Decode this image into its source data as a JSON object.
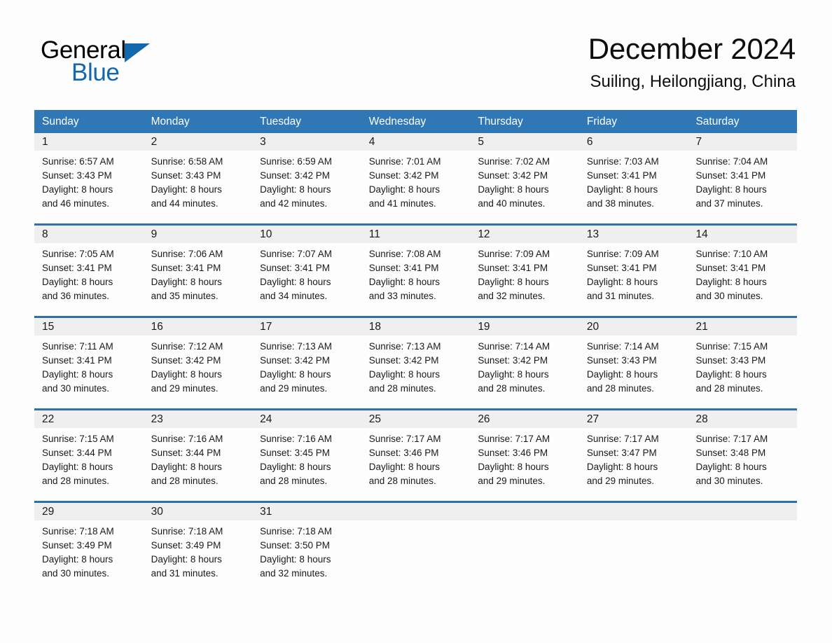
{
  "brand": {
    "name_part1": "General",
    "name_part2": "Blue",
    "triangle_color": "#1268ad"
  },
  "header": {
    "month_title": "December 2024",
    "location": "Suiling, Heilongjiang, China"
  },
  "theme": {
    "header_blue": "#3077b6",
    "row_divider_blue": "#2f6fae",
    "daynum_band": "#efefef",
    "page_background": "#fdfdfd",
    "text_color": "#1a1a1a"
  },
  "calendar": {
    "weekdays": [
      "Sunday",
      "Monday",
      "Tuesday",
      "Wednesday",
      "Thursday",
      "Friday",
      "Saturday"
    ],
    "weeks": [
      [
        {
          "day": "1",
          "lines": [
            "Sunrise: 6:57 AM",
            "Sunset: 3:43 PM",
            "Daylight: 8 hours",
            "and 46 minutes."
          ]
        },
        {
          "day": "2",
          "lines": [
            "Sunrise: 6:58 AM",
            "Sunset: 3:43 PM",
            "Daylight: 8 hours",
            "and 44 minutes."
          ]
        },
        {
          "day": "3",
          "lines": [
            "Sunrise: 6:59 AM",
            "Sunset: 3:42 PM",
            "Daylight: 8 hours",
            "and 42 minutes."
          ]
        },
        {
          "day": "4",
          "lines": [
            "Sunrise: 7:01 AM",
            "Sunset: 3:42 PM",
            "Daylight: 8 hours",
            "and 41 minutes."
          ]
        },
        {
          "day": "5",
          "lines": [
            "Sunrise: 7:02 AM",
            "Sunset: 3:42 PM",
            "Daylight: 8 hours",
            "and 40 minutes."
          ]
        },
        {
          "day": "6",
          "lines": [
            "Sunrise: 7:03 AM",
            "Sunset: 3:41 PM",
            "Daylight: 8 hours",
            "and 38 minutes."
          ]
        },
        {
          "day": "7",
          "lines": [
            "Sunrise: 7:04 AM",
            "Sunset: 3:41 PM",
            "Daylight: 8 hours",
            "and 37 minutes."
          ]
        }
      ],
      [
        {
          "day": "8",
          "lines": [
            "Sunrise: 7:05 AM",
            "Sunset: 3:41 PM",
            "Daylight: 8 hours",
            "and 36 minutes."
          ]
        },
        {
          "day": "9",
          "lines": [
            "Sunrise: 7:06 AM",
            "Sunset: 3:41 PM",
            "Daylight: 8 hours",
            "and 35 minutes."
          ]
        },
        {
          "day": "10",
          "lines": [
            "Sunrise: 7:07 AM",
            "Sunset: 3:41 PM",
            "Daylight: 8 hours",
            "and 34 minutes."
          ]
        },
        {
          "day": "11",
          "lines": [
            "Sunrise: 7:08 AM",
            "Sunset: 3:41 PM",
            "Daylight: 8 hours",
            "and 33 minutes."
          ]
        },
        {
          "day": "12",
          "lines": [
            "Sunrise: 7:09 AM",
            "Sunset: 3:41 PM",
            "Daylight: 8 hours",
            "and 32 minutes."
          ]
        },
        {
          "day": "13",
          "lines": [
            "Sunrise: 7:09 AM",
            "Sunset: 3:41 PM",
            "Daylight: 8 hours",
            "and 31 minutes."
          ]
        },
        {
          "day": "14",
          "lines": [
            "Sunrise: 7:10 AM",
            "Sunset: 3:41 PM",
            "Daylight: 8 hours",
            "and 30 minutes."
          ]
        }
      ],
      [
        {
          "day": "15",
          "lines": [
            "Sunrise: 7:11 AM",
            "Sunset: 3:41 PM",
            "Daylight: 8 hours",
            "and 30 minutes."
          ]
        },
        {
          "day": "16",
          "lines": [
            "Sunrise: 7:12 AM",
            "Sunset: 3:42 PM",
            "Daylight: 8 hours",
            "and 29 minutes."
          ]
        },
        {
          "day": "17",
          "lines": [
            "Sunrise: 7:13 AM",
            "Sunset: 3:42 PM",
            "Daylight: 8 hours",
            "and 29 minutes."
          ]
        },
        {
          "day": "18",
          "lines": [
            "Sunrise: 7:13 AM",
            "Sunset: 3:42 PM",
            "Daylight: 8 hours",
            "and 28 minutes."
          ]
        },
        {
          "day": "19",
          "lines": [
            "Sunrise: 7:14 AM",
            "Sunset: 3:42 PM",
            "Daylight: 8 hours",
            "and 28 minutes."
          ]
        },
        {
          "day": "20",
          "lines": [
            "Sunrise: 7:14 AM",
            "Sunset: 3:43 PM",
            "Daylight: 8 hours",
            "and 28 minutes."
          ]
        },
        {
          "day": "21",
          "lines": [
            "Sunrise: 7:15 AM",
            "Sunset: 3:43 PM",
            "Daylight: 8 hours",
            "and 28 minutes."
          ]
        }
      ],
      [
        {
          "day": "22",
          "lines": [
            "Sunrise: 7:15 AM",
            "Sunset: 3:44 PM",
            "Daylight: 8 hours",
            "and 28 minutes."
          ]
        },
        {
          "day": "23",
          "lines": [
            "Sunrise: 7:16 AM",
            "Sunset: 3:44 PM",
            "Daylight: 8 hours",
            "and 28 minutes."
          ]
        },
        {
          "day": "24",
          "lines": [
            "Sunrise: 7:16 AM",
            "Sunset: 3:45 PM",
            "Daylight: 8 hours",
            "and 28 minutes."
          ]
        },
        {
          "day": "25",
          "lines": [
            "Sunrise: 7:17 AM",
            "Sunset: 3:46 PM",
            "Daylight: 8 hours",
            "and 28 minutes."
          ]
        },
        {
          "day": "26",
          "lines": [
            "Sunrise: 7:17 AM",
            "Sunset: 3:46 PM",
            "Daylight: 8 hours",
            "and 29 minutes."
          ]
        },
        {
          "day": "27",
          "lines": [
            "Sunrise: 7:17 AM",
            "Sunset: 3:47 PM",
            "Daylight: 8 hours",
            "and 29 minutes."
          ]
        },
        {
          "day": "28",
          "lines": [
            "Sunrise: 7:17 AM",
            "Sunset: 3:48 PM",
            "Daylight: 8 hours",
            "and 30 minutes."
          ]
        }
      ],
      [
        {
          "day": "29",
          "lines": [
            "Sunrise: 7:18 AM",
            "Sunset: 3:49 PM",
            "Daylight: 8 hours",
            "and 30 minutes."
          ]
        },
        {
          "day": "30",
          "lines": [
            "Sunrise: 7:18 AM",
            "Sunset: 3:49 PM",
            "Daylight: 8 hours",
            "and 31 minutes."
          ]
        },
        {
          "day": "31",
          "lines": [
            "Sunrise: 7:18 AM",
            "Sunset: 3:50 PM",
            "Daylight: 8 hours",
            "and 32 minutes."
          ]
        },
        {
          "day": "",
          "lines": [
            "",
            "",
            "",
            ""
          ]
        },
        {
          "day": "",
          "lines": [
            "",
            "",
            "",
            ""
          ]
        },
        {
          "day": "",
          "lines": [
            "",
            "",
            "",
            ""
          ]
        },
        {
          "day": "",
          "lines": [
            "",
            "",
            "",
            ""
          ]
        }
      ]
    ]
  }
}
